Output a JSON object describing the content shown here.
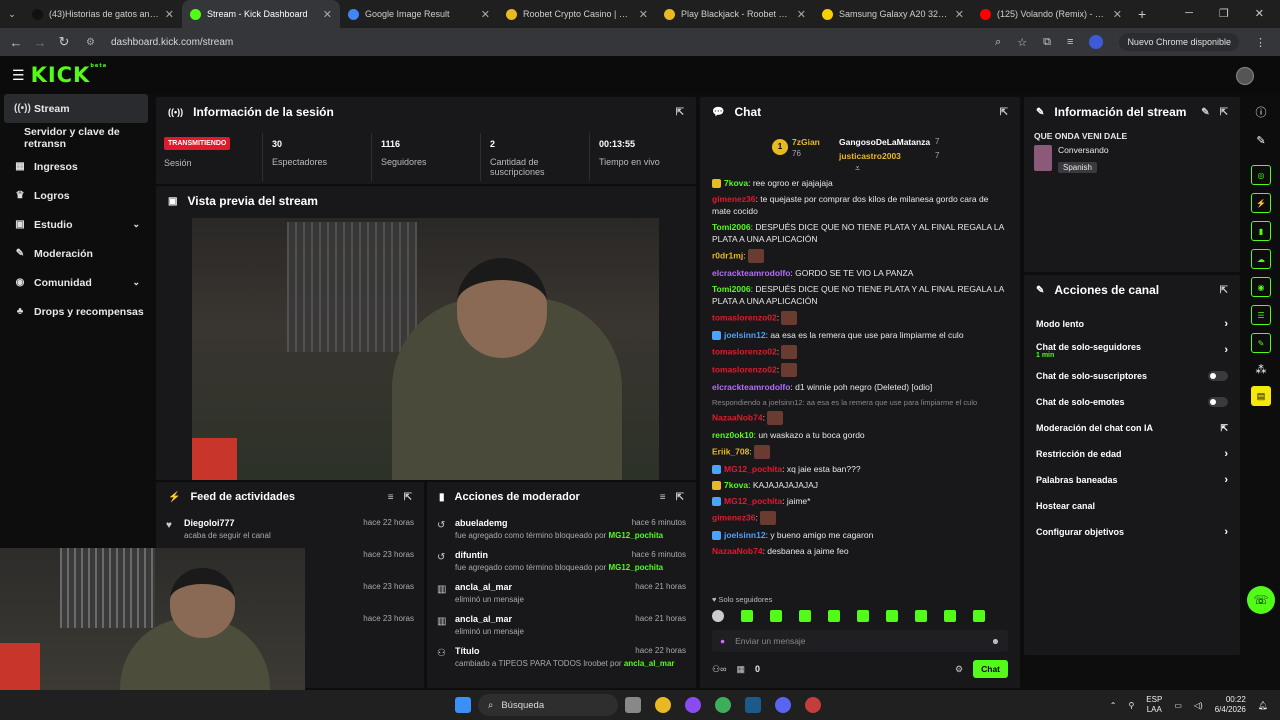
{
  "browser": {
    "tabs": [
      {
        "title": "(43)Historias de gatos animado",
        "color": "#111"
      },
      {
        "title": "Stream - Kick Dashboard",
        "color": "#53fc18",
        "active": true
      },
      {
        "title": "Google Image Result",
        "color": "#4285f4"
      },
      {
        "title": "Roobet Crypto Casino | Best Bi",
        "color": "#e8b923"
      },
      {
        "title": "Play Blackjack - Roobet Crypto",
        "color": "#e8b923"
      },
      {
        "title": "Samsung Galaxy A20 32 GB Az",
        "color": "#f7d000"
      },
      {
        "title": "(125) Volando (Remix) - YouTub",
        "color": "#ff0000"
      }
    ],
    "url": "dashboard.kick.com/stream",
    "update_label": "Nuevo Chrome disponible"
  },
  "header": {
    "logo": "KICK",
    "logo_badge": "beta"
  },
  "sidebar": {
    "items": [
      {
        "label": "Stream",
        "icon": "broadcast-icon",
        "glyph": "((•))"
      },
      {
        "label": "Servidor y clave de retransn",
        "icon": "",
        "glyph": ""
      },
      {
        "label": "Ingresos",
        "icon": "money-icon",
        "glyph": "▦"
      },
      {
        "label": "Logros",
        "icon": "trophy-icon",
        "glyph": "♛"
      },
      {
        "label": "Estudio",
        "icon": "studio-icon",
        "glyph": "▣"
      },
      {
        "label": "Moderación",
        "icon": "wrench-icon",
        "glyph": "✎"
      },
      {
        "label": "Comunidad",
        "icon": "community-icon",
        "glyph": "◉"
      },
      {
        "label": "Drops y recompensas",
        "icon": "gift-icon",
        "glyph": "♣"
      }
    ]
  },
  "session": {
    "title": "Información de la sesión",
    "live_badge": "TRANSMITIENDO",
    "live_label": "Sesión",
    "stats": [
      {
        "value": "30",
        "label": "Espectadores"
      },
      {
        "value": "1116",
        "label": "Seguidores"
      },
      {
        "value": "2",
        "label": "Cantidad de suscripciones"
      },
      {
        "value": "00:13:55",
        "label": "Tiempo en vivo"
      }
    ]
  },
  "preview": {
    "title": "Vista previa del stream"
  },
  "activity": {
    "title": "Feed de actividades",
    "rows": [
      {
        "name": "Diegoloi777",
        "sub": "acaba de seguir el canal",
        "time": "hace 22 horas"
      },
      {
        "name": "",
        "sub": "",
        "time": "hace 23 horas"
      },
      {
        "name": "",
        "sub": "",
        "time": "hace 23 horas"
      },
      {
        "name": "",
        "sub": "",
        "time": "hace 23 horas"
      }
    ]
  },
  "modactions": {
    "title": "Acciones de moderador",
    "rows": [
      {
        "name": "abuelademg",
        "sub": "fue agregado como término bloqueado por",
        "by": "MG12_pochita",
        "time": "hace 6 minutos"
      },
      {
        "name": "difuntin",
        "sub": "fue agregado como término bloqueado por",
        "by": "MG12_pochita",
        "time": "hace 6 minutos"
      },
      {
        "name": "ancla_al_mar",
        "sub": "eliminó un mensaje",
        "by": "",
        "time": "hace 21 horas"
      },
      {
        "name": "ancla_al_mar",
        "sub": "eliminó un mensaje",
        "by": "",
        "time": "hace 21 horas"
      },
      {
        "name": "Título",
        "sub": "cambiado a TIPEOS PARA TODOS lroobet por",
        "by": "ancla_al_mar",
        "time": "hace 22 horas"
      }
    ]
  },
  "chat": {
    "title": "Chat",
    "leaders": {
      "rank": "1",
      "top_name": "7zGian",
      "top_val": "76",
      "n1": "GangosoDeLaMatanza",
      "v1": "7",
      "n2": "justicastro2003",
      "v2": "7"
    },
    "messages": [
      {
        "user": "7kova",
        "color": "#53fc18",
        "text": "ree ogroo er ajajajaja"
      },
      {
        "user": "gimenez36",
        "color": "#e3192b",
        "text": "te quejaste por comprar dos kilos de milanesa gordo cara de mate cocido"
      },
      {
        "user": "Tomi2006",
        "color": "#53fc18",
        "text": "DESPUÉS DICE QUE NO TIENE PLATA Y AL FINAL REGALA LA PLATA A UNA APLICACIÓN"
      },
      {
        "user": "r0dr1mj",
        "color": "#e8b923",
        "text": "",
        "emote": true
      },
      {
        "user": "elcrackteamrodolfo",
        "color": "#b46cff",
        "text": "GORDO SE TE VIO LA PANZA"
      },
      {
        "user": "Tomi2006",
        "color": "#53fc18",
        "text": "DESPUÉS DICE QUE NO TIENE PLATA Y AL FINAL REGALA LA PLATA A UNA APLICACIÓN"
      },
      {
        "user": "tomaslorenzo02",
        "color": "#e3192b",
        "text": "",
        "emote": true
      },
      {
        "user": "joelsinn12",
        "color": "#4aa3ff",
        "text": "aa esa es la remera que use para limpiarme el culo"
      },
      {
        "user": "tomaslorenzo02",
        "color": "#e3192b",
        "text": "",
        "emote": true
      },
      {
        "user": "tomaslorenzo02",
        "color": "#e3192b",
        "text": "",
        "emote": true
      },
      {
        "user": "elcrackteamrodolfo",
        "color": "#b46cff",
        "text": "d1 winnie poh negro (Deleted) [odio]"
      },
      {
        "user": "NazaaNob74",
        "color": "#e3192b",
        "text": "",
        "emote": true,
        "reply": "Respondiendo a joelsinn12: aa esa es la remera que use para limpiarme el culo"
      },
      {
        "user": "renz0ok10",
        "color": "#53fc18",
        "text": "un waskazo a tu boca gordo"
      },
      {
        "user": "Eriik_708",
        "color": "#e8b923",
        "text": "",
        "emote": true
      },
      {
        "user": "MG12_pochita",
        "color": "#e3192b",
        "text": "xq jaie esta ban???"
      },
      {
        "user": "7kova",
        "color": "#53fc18",
        "text": "KAJAJAJAJAJAJ"
      },
      {
        "user": "MG12_pochita",
        "color": "#e3192b",
        "text": "jaime*"
      },
      {
        "user": "gimenez36",
        "color": "#e3192b",
        "text": "",
        "emote": true
      },
      {
        "user": "joelsinn12",
        "color": "#4aa3ff",
        "text": "y bueno amigo me cagaron"
      },
      {
        "user": "NazaaNob74",
        "color": "#e3192b",
        "text": "desbanea a jaime feo"
      }
    ],
    "followers_only": "Solo seguidores",
    "placeholder": "Enviar un mensaje",
    "count": "0",
    "send_label": "Chat"
  },
  "streaminfo": {
    "title": "Información del stream",
    "stream_title": "QUE ONDA VENI DALE",
    "category": "Conversando",
    "language": "Spanish"
  },
  "channel_actions": {
    "title": "Acciones de canal",
    "rows": [
      {
        "label": "Modo lento",
        "kind": "chev"
      },
      {
        "label": "Chat de solo-seguidores",
        "sub": "1 min",
        "kind": "chev"
      },
      {
        "label": "Chat de solo-suscriptores",
        "kind": "toggle"
      },
      {
        "label": "Chat de solo-emotes",
        "kind": "toggle"
      },
      {
        "label": "Moderación del chat con IA",
        "kind": "ext"
      },
      {
        "label": "Restricción de edad",
        "kind": "chev"
      },
      {
        "label": "Palabras baneadas",
        "kind": "chev"
      },
      {
        "label": "Hostear canal",
        "kind": "none"
      },
      {
        "label": "Configurar objetivos",
        "kind": "chev"
      }
    ]
  },
  "taskbar": {
    "search": "Búsqueda",
    "lang": "ESP",
    "lang2": "LAA",
    "time": "00:22",
    "date": "6/4/2026"
  }
}
